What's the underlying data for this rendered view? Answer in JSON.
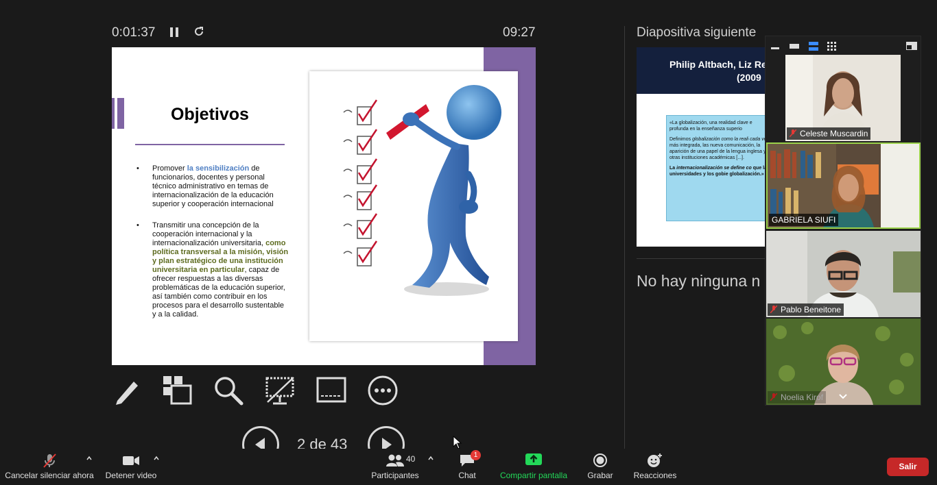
{
  "presenter": {
    "elapsed": "0:01:37",
    "clock": "09:27",
    "page_count": "2 de 43"
  },
  "slide": {
    "title": "Objetivos",
    "bullet1": {
      "pre": "Promover ",
      "highlight": "la sensibilización",
      "post": " de funcionarios, docentes y personal técnico administrativo en temas de internacionalización de la educación superior y cooperación internacional"
    },
    "bullet2": {
      "pre": "Transmitir una concepción de la cooperación internacional  y la internacionalización universitaria, ",
      "highlight": "como política transversal a la misión, visión y plan estratégico de una institución universitaria en particular",
      "post": ", capaz de ofrecer respuestas a las diversas problemáticas de la educación superior, así también como contribuir en los procesos para el desarrollo sustentable y a la calidad."
    },
    "bullet_symbol": "•"
  },
  "next_slide": {
    "label": "Diapositiva siguiente",
    "title_line1": "Philip Altbach, Liz Re",
    "title_line2": "(2009",
    "quote_p1": "«La globalización, una realidad clave e profunda en la enseñanza superio",
    "quote_p2a": "Definimos ",
    "quote_p2b": "globalización como la reali cada vez",
    "quote_p2c": " más integrada, las nueva comunicación, la aparición de una papel de la lengua inglesa y otras instituciones académicas [...].",
    "quote_p3a": "La ",
    "quote_p3b": "internacionalización se define co",
    "quote_p3c": " que las universidades y los gobie globalización.»"
  },
  "notes": {
    "empty_message": "No hay ninguna n"
  },
  "participants_tiles": [
    {
      "name": "Celeste Muscardin",
      "muted": true
    },
    {
      "name": "GABRIELA SIUFI",
      "muted": false
    },
    {
      "name": "Pablo Beneitone",
      "muted": true
    },
    {
      "name": "Noelia Kirof",
      "muted": true
    }
  ],
  "toolbar": {
    "mute_label": "Cancelar silenciar ahora",
    "video_label": "Detener video",
    "participants_label": "Participantes",
    "participants_count": "40",
    "chat_label": "Chat",
    "chat_badge": "1",
    "share_label": "Compartir pantalla",
    "record_label": "Grabar",
    "reactions_label": "Reacciones",
    "leave_label": "Salir"
  },
  "colors": {
    "slide_purple": "#7f64a3",
    "share_green": "#23d959",
    "leave_red": "#c62828",
    "active_speaker": "#9bd24a"
  }
}
